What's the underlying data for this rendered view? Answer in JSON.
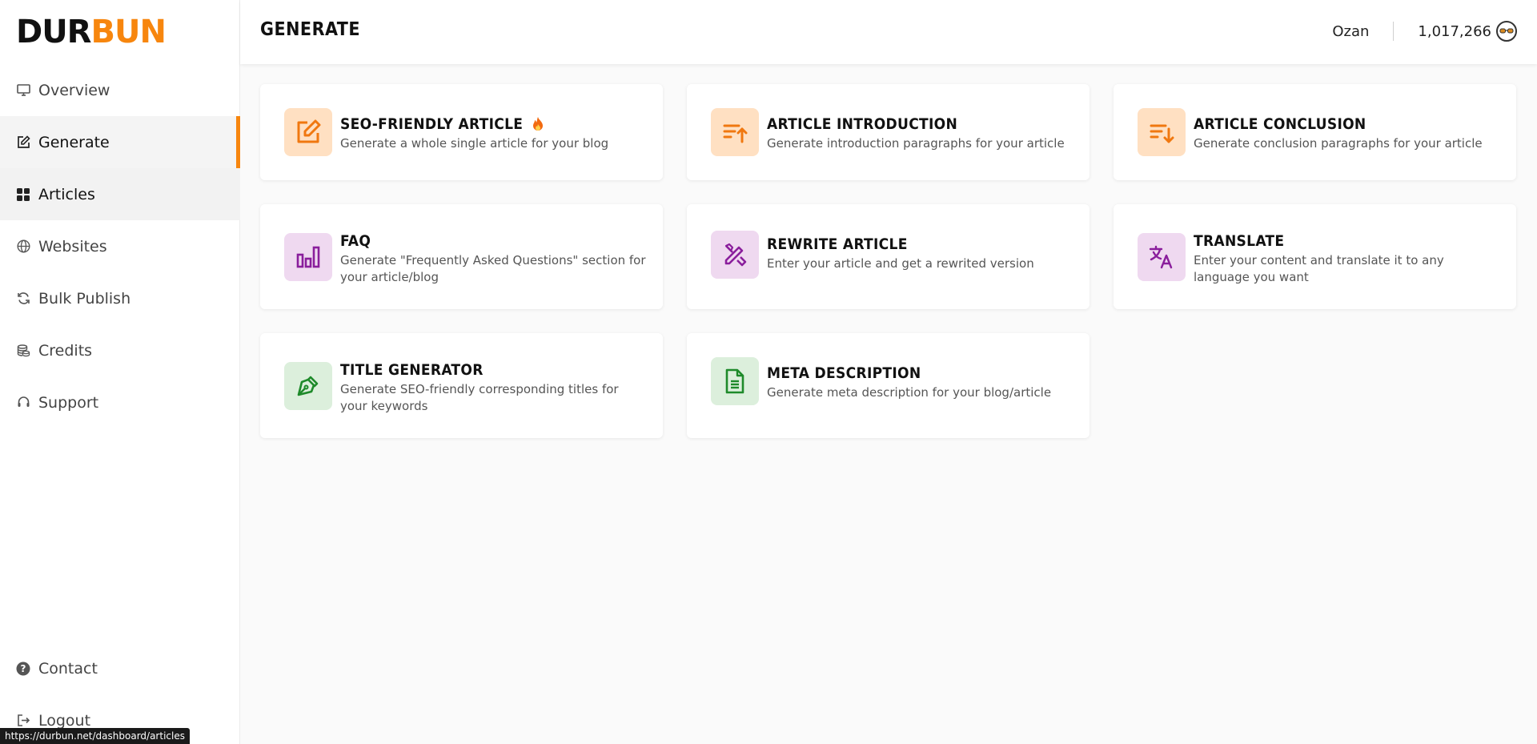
{
  "brand": {
    "part1": "DUR",
    "part2": "BUN",
    "accent": "#f7860e"
  },
  "nav": {
    "items": [
      {
        "label": "Overview",
        "icon": "monitor-icon"
      },
      {
        "label": "Generate",
        "icon": "edit-icon"
      },
      {
        "label": "Articles",
        "icon": "grid-icon"
      },
      {
        "label": "Websites",
        "icon": "globe-icon"
      },
      {
        "label": "Bulk Publish",
        "icon": "refresh-icon"
      },
      {
        "label": "Credits",
        "icon": "coins-icon"
      },
      {
        "label": "Support",
        "icon": "headset-icon"
      }
    ],
    "bottom": [
      {
        "label": "Contact",
        "icon": "question-circle-icon"
      },
      {
        "label": "Logout",
        "icon": "logout-icon"
      }
    ]
  },
  "header": {
    "title": "GENERATE",
    "user": "Ozan",
    "credits": "1,017,266"
  },
  "cards": [
    {
      "title": "SEO-FRIENDLY ARTICLE",
      "desc": "Generate a whole single article for your blog",
      "icon": "edit-icon",
      "badge": "fire-icon"
    },
    {
      "title": "ARTICLE INTRODUCTION",
      "desc": "Generate introduction paragraphs for your article",
      "icon": "sort-up-icon"
    },
    {
      "title": "ARTICLE CONCLUSION",
      "desc": "Generate conclusion paragraphs for your article",
      "icon": "sort-down-icon"
    },
    {
      "title": "FAQ",
      "desc": "Generate \"Frequently Asked Questions\" section for your article/blog",
      "icon": "bar-chart-icon"
    },
    {
      "title": "REWRITE ARTICLE",
      "desc": "Enter your article and get a rewrited version",
      "icon": "pencil-ruler-icon"
    },
    {
      "title": "TRANSLATE",
      "desc": "Enter your content and translate it to any language you want",
      "icon": "translate-icon"
    },
    {
      "title": "TITLE GENERATOR",
      "desc": "Generate SEO-friendly corresponding titles for your keywords",
      "icon": "pen-nib-icon"
    },
    {
      "title": "META DESCRIPTION",
      "desc": "Generate meta description for your blog/article",
      "icon": "document-icon"
    }
  ],
  "status_url": "https://durbun.net/dashboard/articles"
}
